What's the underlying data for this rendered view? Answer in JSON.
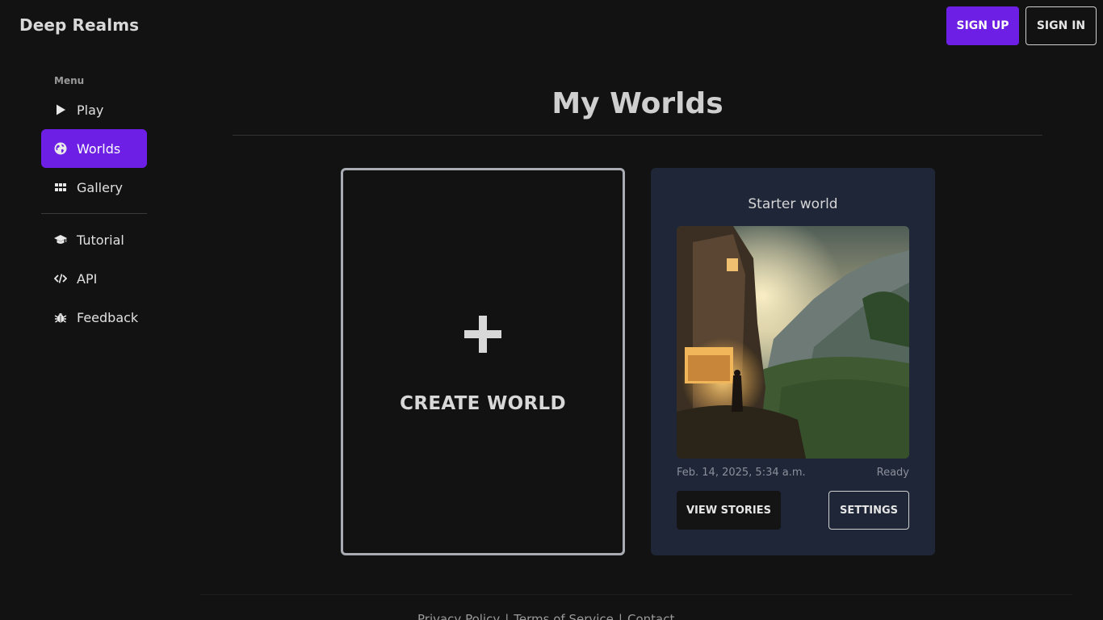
{
  "header": {
    "brand": "Deep Realms",
    "signup_label": "SIGN UP",
    "signin_label": "SIGN IN"
  },
  "sidebar": {
    "menu_label": "Menu",
    "items": [
      {
        "label": "Play",
        "icon": "play-icon",
        "active": false
      },
      {
        "label": "Worlds",
        "icon": "globe-icon",
        "active": true
      },
      {
        "label": "Gallery",
        "icon": "grid-icon",
        "active": false
      },
      {
        "label": "Tutorial",
        "icon": "graduation-cap-icon",
        "active": false
      },
      {
        "label": "API",
        "icon": "code-icon",
        "active": false
      },
      {
        "label": "Feedback",
        "icon": "bug-icon",
        "active": false
      }
    ]
  },
  "main": {
    "title": "My Worlds",
    "create_card": {
      "label": "CREATE WORLD",
      "icon": "plus-icon"
    },
    "worlds": [
      {
        "title": "Starter world",
        "date": "Feb. 14, 2025, 5:34 a.m.",
        "status": "Ready",
        "view_label": "VIEW STORIES",
        "settings_label": "SETTINGS"
      }
    ]
  },
  "footer": {
    "links": [
      "Privacy Policy",
      "Terms of Service",
      "Contact"
    ]
  },
  "colors": {
    "accent": "#6d1fe6",
    "background": "#121212",
    "card": "#1f2638"
  }
}
